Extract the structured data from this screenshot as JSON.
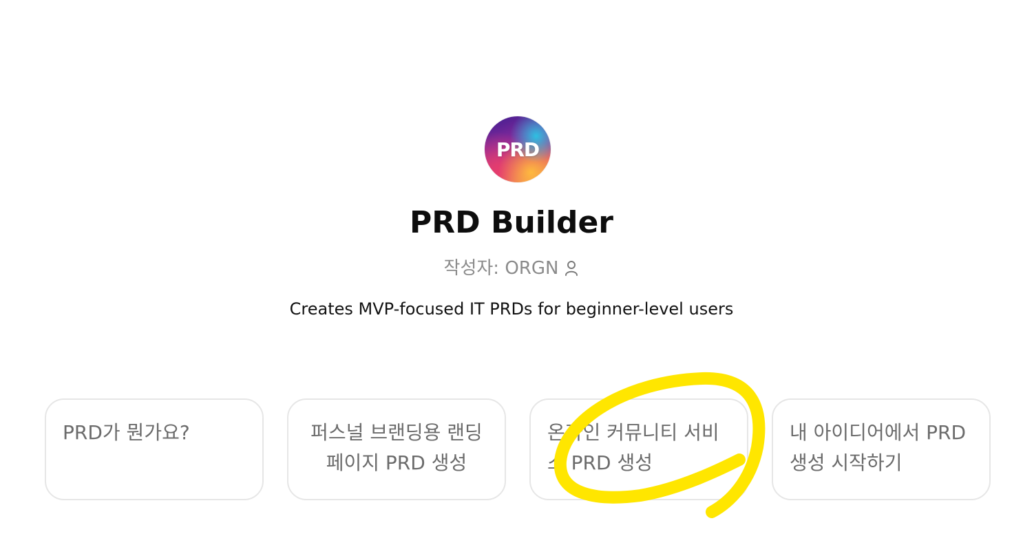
{
  "gpt": {
    "logo_text": "PRD",
    "name": "PRD Builder",
    "author_label": "작성자: ORGN",
    "description": "Creates MVP-focused IT PRDs for beginner-level users"
  },
  "prompt_starters": [
    {
      "label": "PRD가 뭔가요?"
    },
    {
      "label": "퍼스널 브랜딩용 랜딩페이지 PRD 생성"
    },
    {
      "label": "온라인 커뮤니티 서비스 PRD 생성"
    },
    {
      "label": "내 아이디어에서 PRD 생성 시작하기"
    }
  ],
  "colors": {
    "highlight": "#FFE600",
    "card_border": "#e6e6e6",
    "muted_text": "#8b8b8b"
  },
  "icons": {
    "author": "user-icon"
  }
}
